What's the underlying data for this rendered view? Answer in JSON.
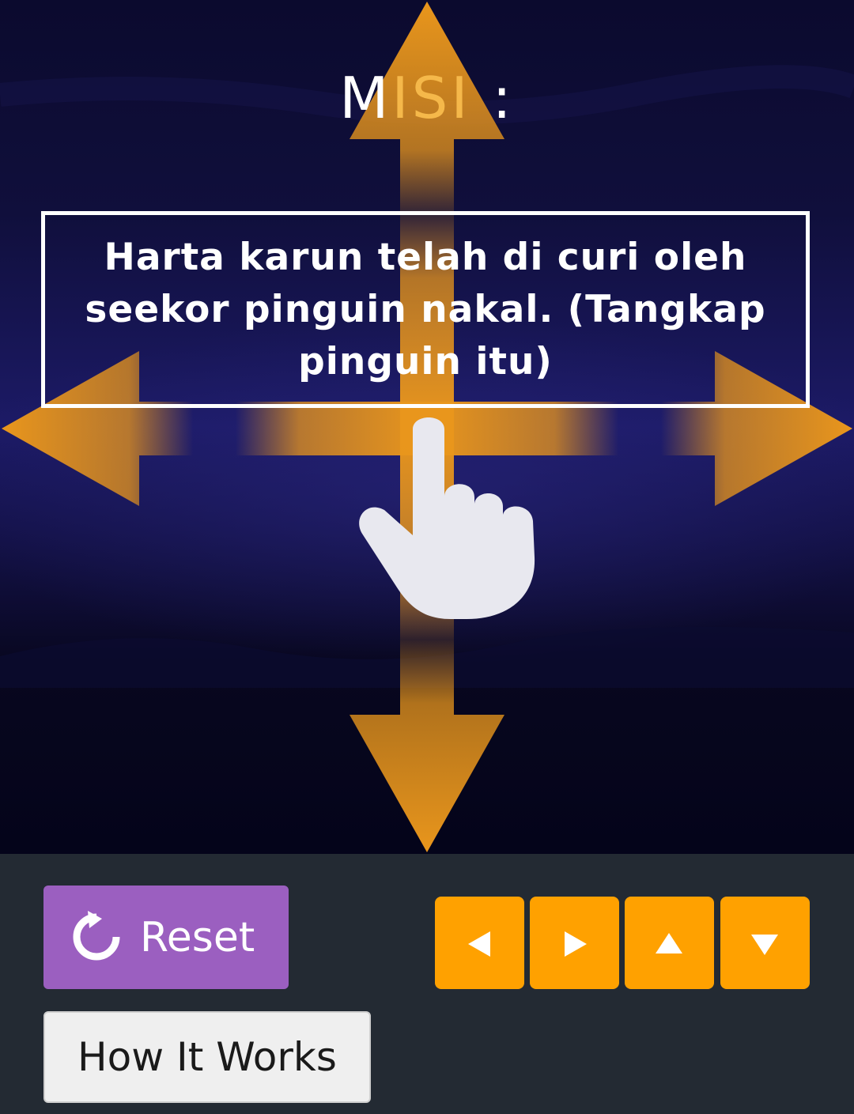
{
  "game": {
    "title_prefix": "M",
    "title_accent": "ISI",
    "title_suffix": " :",
    "mission_text": "Harta karun telah di curi oleh seekor pinguin nakal. (Tangkap pinguin itu)",
    "arrow_color": "#e0901a",
    "hand_icon": "pointing-hand-icon"
  },
  "controls": {
    "reset_label": "Reset",
    "reset_icon": "refresh-icon",
    "reset_color": "#9b5fc0",
    "how_label": "How It Works",
    "direction_buttons": [
      {
        "name": "left",
        "icon": "triangle-left-icon"
      },
      {
        "name": "right",
        "icon": "triangle-right-icon"
      },
      {
        "name": "up",
        "icon": "triangle-up-icon"
      },
      {
        "name": "down",
        "icon": "triangle-down-icon"
      }
    ],
    "direction_color": "#ffa100"
  }
}
